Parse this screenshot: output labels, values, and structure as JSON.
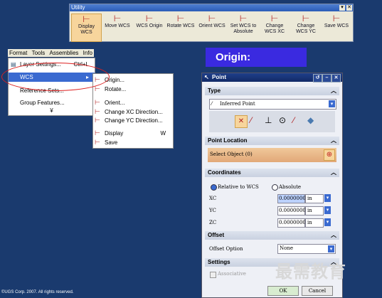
{
  "utility": {
    "title": "Utility",
    "tools": [
      {
        "line1": "Display",
        "line2": "WCS",
        "icon": "display-wcs-icon"
      },
      {
        "line1": "Move WCS",
        "line2": "",
        "icon": "move-wcs-icon"
      },
      {
        "line1": "WCS Origin",
        "line2": "",
        "icon": "wcs-origin-icon"
      },
      {
        "line1": "Rotate WCS",
        "line2": "",
        "icon": "rotate-wcs-icon"
      },
      {
        "line1": "Orient WCS",
        "line2": "",
        "icon": "orient-wcs-icon"
      },
      {
        "line1": "Set WCS to",
        "line2": "Absolute",
        "icon": "set-wcs-absolute-icon"
      },
      {
        "line1": "Change",
        "line2": "WCS XC",
        "icon": "change-wcs-xc-icon"
      },
      {
        "line1": "Change",
        "line2": "WCS YC",
        "icon": "change-wcs-yc-icon"
      },
      {
        "line1": "Save WCS",
        "line2": "",
        "icon": "save-wcs-icon"
      }
    ]
  },
  "menubar": {
    "format": "Format",
    "tools": "Tools",
    "assemblies": "Assemblies",
    "info": "Info"
  },
  "format_menu": {
    "layer_settings": "Layer Settings...",
    "layer_settings_shortcut": "Ctrl+L",
    "wcs": "WCS",
    "reference_sets": "Reference Sets...",
    "group_features": "Group Features...",
    "more": "¥"
  },
  "wcs_menu": {
    "origin": "Origin...",
    "rotate": "Rotate...",
    "orient": "Orient...",
    "change_xc": "Change XC Direction...",
    "change_yc": "Change YC Direction...",
    "display": "Display",
    "display_shortcut": "W",
    "save": "Save"
  },
  "origin_label": "Origin:",
  "point_dialog": {
    "title": "Point",
    "type_section": "Type",
    "type_value": "Inferred Point",
    "point_location_section": "Point Location",
    "select_object": "Select Object (0)",
    "coordinates_section": "Coordinates",
    "relative_to_wcs": "Relative to WCS",
    "absolute": "Absolute",
    "xc_label": "XC",
    "yc_label": "YC",
    "zc_label": "ZC",
    "xc_value": "0.0000000",
    "yc_value": "0.0000000",
    "zc_value": "0.0000000",
    "unit": "in",
    "offset_section": "Offset",
    "offset_option_label": "Offset Option",
    "offset_option_value": "None",
    "settings_section": "Settings",
    "associative": "Associative",
    "ok": "OK",
    "cancel": "Cancel"
  },
  "footer": "©UGS Corp. 2007. All rights reserved.",
  "watermark": "最需教育",
  "colors": {
    "background": "#1a3a6e",
    "origin_box": "#3a2ae0",
    "highlight": "#3a6ad0"
  }
}
